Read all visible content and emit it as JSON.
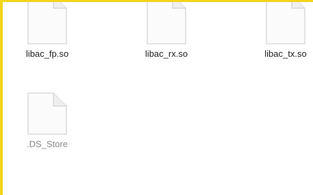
{
  "window": {
    "accent": "#f2d51a"
  },
  "files": [
    {
      "name": "libac_fp.so",
      "icon": "document-icon",
      "hidden": false
    },
    {
      "name": "libac_rx.so",
      "icon": "document-icon",
      "hidden": false
    },
    {
      "name": "libac_tx.so",
      "icon": "document-icon",
      "hidden": false
    },
    {
      "name": ".DS_Store",
      "icon": "document-icon",
      "hidden": true
    }
  ]
}
